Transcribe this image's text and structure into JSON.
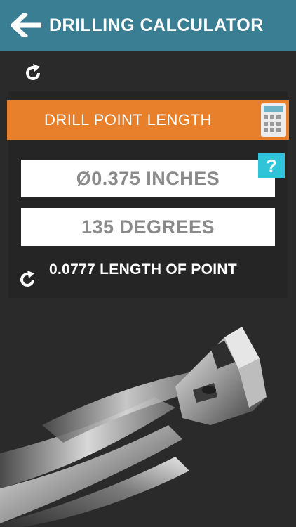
{
  "header": {
    "title": "DRILLING CALCULATOR"
  },
  "mode": {
    "label": "DRILL POINT LENGTH"
  },
  "inputs": {
    "diameter_value": "Ø0.375 INCHES",
    "angle_value": "135 DEGREES"
  },
  "help": {
    "label": "?"
  },
  "result": {
    "text": "0.0777 LENGTH OF POINT"
  },
  "icons": {
    "back": "arrow-left-icon",
    "reset": "refresh-icon",
    "calculator": "calculator-icon",
    "illustration": "drill-bit-illustration"
  },
  "colors": {
    "header": "#3a7e93",
    "accent": "#e87f2b",
    "help": "#2fc4d8",
    "background": "#2a2a2a"
  }
}
